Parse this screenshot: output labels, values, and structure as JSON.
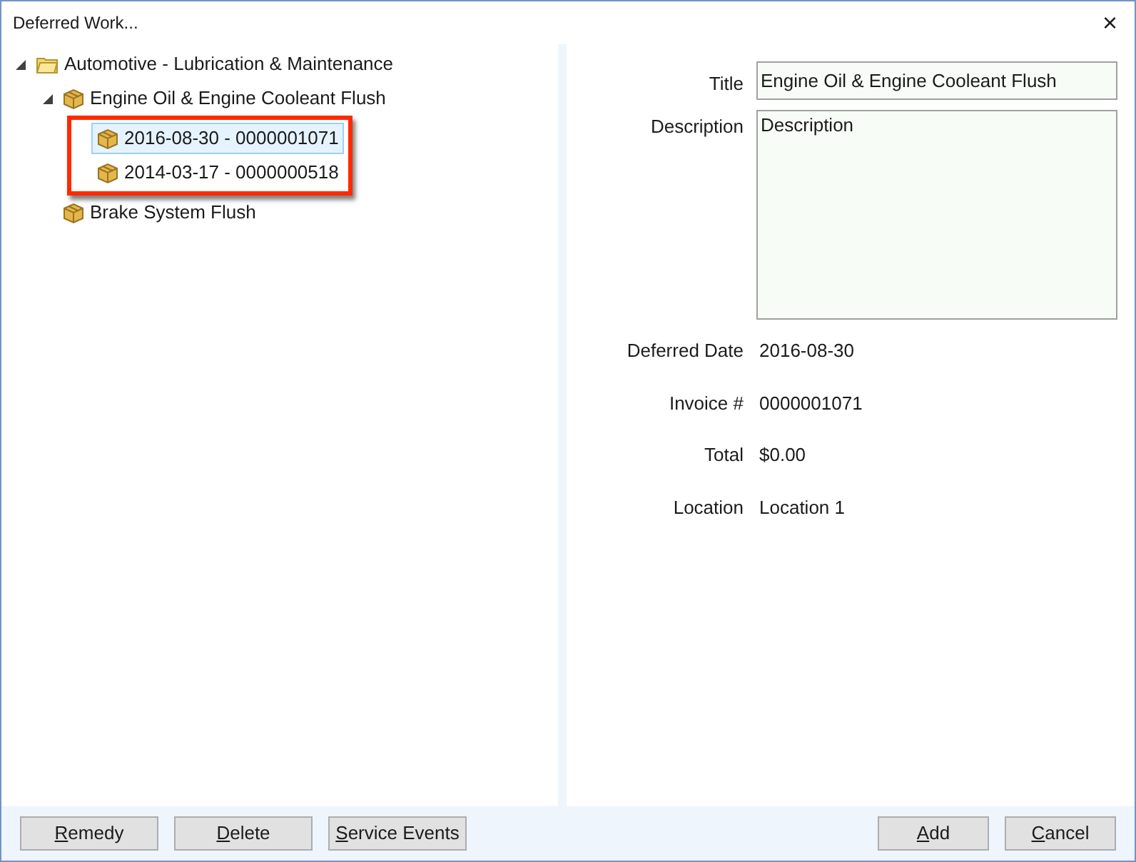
{
  "window": {
    "title": "Deferred Work...",
    "close": "×"
  },
  "tree": [
    {
      "label": "Automotive - Lubrication & Maintenance",
      "kind": "folder",
      "expanded": true,
      "selected": false,
      "children": [
        {
          "label": "Engine Oil & Engine Cooleant Flush",
          "kind": "package",
          "expanded": true,
          "selected": false,
          "children_highlighted": true,
          "children": [
            {
              "label": "2016-08-30 - 0000001071",
              "kind": "package",
              "selected": true
            },
            {
              "label": "2014-03-17 - 0000000518",
              "kind": "package",
              "selected": false
            }
          ]
        },
        {
          "label": "Brake System Flush",
          "kind": "package",
          "selected": false
        }
      ]
    }
  ],
  "form": {
    "title": {
      "label": "Title",
      "value": "Engine Oil & Engine Cooleant Flush"
    },
    "description": {
      "label": "Description",
      "value": "Description"
    },
    "fields": [
      {
        "label": "Deferred Date",
        "value": "2016-08-30"
      },
      {
        "label": "Invoice #",
        "value": "0000001071"
      },
      {
        "label": "Total",
        "value": "$0.00"
      },
      {
        "label": "Location",
        "value": "Location 1"
      }
    ]
  },
  "buttons_left": [
    {
      "label": "Remedy",
      "underline_first": true
    },
    {
      "label": "Delete",
      "underline_first": true
    },
    {
      "label": "Service Events",
      "underline_first": true
    }
  ],
  "buttons_right": [
    {
      "label": "Add",
      "underline_first": true
    },
    {
      "label": "Cancel",
      "underline_first": true
    }
  ]
}
